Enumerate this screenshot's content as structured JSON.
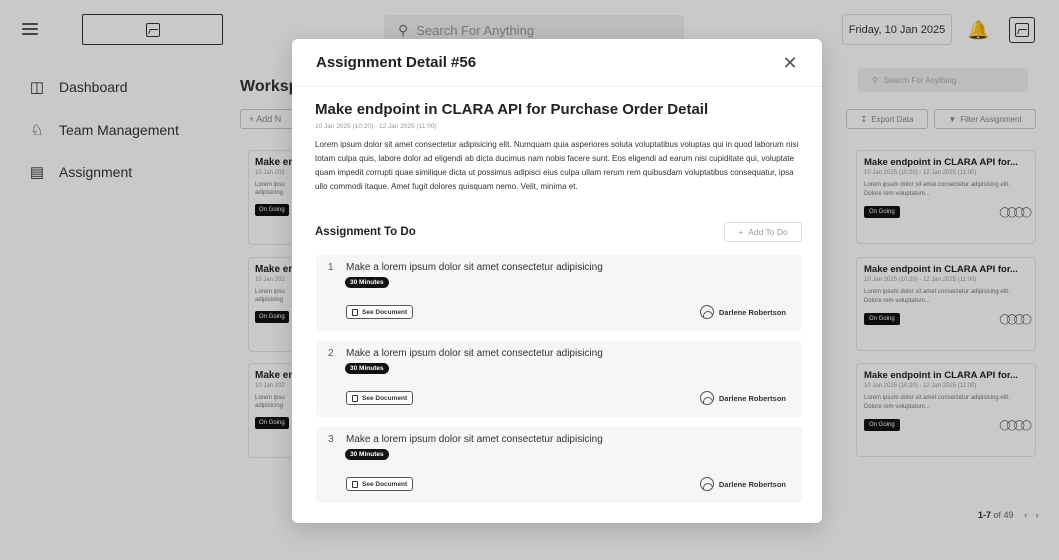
{
  "topbar": {
    "search_placeholder": "Search For Anything",
    "date": "Friday, 10 Jan 2025"
  },
  "sidebar": {
    "items": [
      {
        "label": "Dashboard",
        "icon": "dashboard-icon"
      },
      {
        "label": "Team Management",
        "icon": "team-icon"
      },
      {
        "label": "Assignment",
        "icon": "assignment-icon"
      }
    ]
  },
  "workspace": {
    "title": "Worksp",
    "add_label": "+ Add N",
    "search_placeholder": "Search For Anything",
    "export_label": "Export Data",
    "filter_label": "Filter Assignment",
    "left_cards": [
      {
        "title": "Make en",
        "dates": "10 Jan 202",
        "text": "Lorem ipsu adipisicing",
        "status": "On Going"
      },
      {
        "title": "Make en",
        "dates": "10 Jan 202",
        "text": "Lorem ipsu adipisicing",
        "status": "On Going"
      },
      {
        "title": "Make en",
        "dates": "10 Jan 202",
        "text": "Lorem ipsu adipisicing",
        "status": "On Going"
      }
    ],
    "right_cards": [
      {
        "title": "Make endpoint in CLARA API for...",
        "dates": "10 Jan 2025 (10:20) - 12 Jan 2025 (11:00)",
        "text": "Lorem ipsum dolor sit amet consectetur adipisicing elit. Dolore rem voluptatum...",
        "status": "On Going"
      },
      {
        "title": "Make endpoint in CLARA API for...",
        "dates": "10 Jan 2025 (10:20) - 12 Jan 2025 (11:00)",
        "text": "Lorem ipsum dolor sit amet consectetur adipisicing elit. Dolore rem voluptatum...",
        "status": "On Going"
      },
      {
        "title": "Make endpoint in CLARA API for...",
        "dates": "10 Jan 2025 (10:20) - 12 Jan 2025 (11:00)",
        "text": "Lorem ipsum dolor sit amet consectetur adipisicing elit. Dolore rem voluptatum...",
        "status": "On Going"
      }
    ],
    "pager_range": "1-7",
    "pager_total": "of 49"
  },
  "modal": {
    "title": "Assignment Detail #56",
    "task_title": "Make endpoint in CLARA API for Purchase Order Detail",
    "task_dates": "10 Jan 2025 (10:20) - 12 Jan 2025 (11:00)",
    "description": "Lorem ipsum dolor sit amet consectetur adipisicing elit. Numquam quia asperiores soluta voluptatibus voluptas qui in quod laborum nisi totam culpa quis, labore dolor ad eligendi ab dicta ducimus nam nobis facere sunt. Eos eligendi ad earum nisi cupiditate qui, voluptate quam impedit corrupti quae similique dicta ut possimus adipisci eius culpa ullam rerum rem quibusdam voluptatibus consequatur, ipsa ullo commodi itaque. Amet fugit dolores quisquam nemo. Velit, minima et.",
    "todo_header": "Assignment To Do",
    "add_todo_label": "Add To Do",
    "todos": [
      {
        "num": "1",
        "text": "Make a lorem ipsum dolor sit amet consectetur adipisicing",
        "duration": "30 Minutes",
        "doc_label": "See Document",
        "assignee": "Darlene Robertson"
      },
      {
        "num": "2",
        "text": "Make a lorem ipsum dolor sit amet consectetur adipisicing",
        "duration": "30 Minutes",
        "doc_label": "See Document",
        "assignee": "Darlene Robertson"
      },
      {
        "num": "3",
        "text": "Make a lorem ipsum dolor sit amet consectetur adipisicing",
        "duration": "30 Minutes",
        "doc_label": "See Document",
        "assignee": "Darlene Robertson"
      }
    ]
  }
}
